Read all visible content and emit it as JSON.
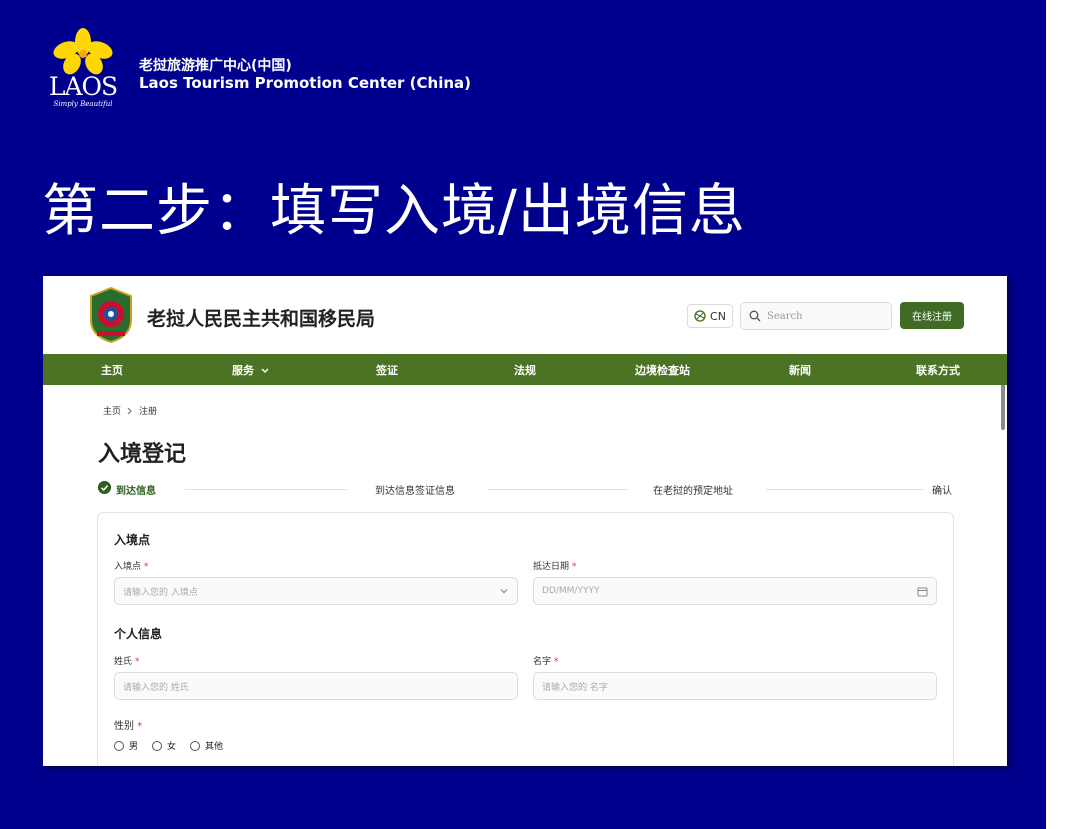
{
  "slide": {
    "org_name_cn": "老挝旅游推广中心(中国)",
    "org_name_en": "Laos Tourism Promotion Center (China)",
    "logo_word": "LAOS",
    "logo_tagline": "Simply Beautiful",
    "title": "第二步：填写入境/出境信息"
  },
  "site": {
    "title": "老挝人民民主共和国移民局",
    "lang_label": "CN",
    "search_placeholder": "Search",
    "register_button": "在线注册"
  },
  "nav": {
    "items": [
      "主页",
      "服务",
      "签证",
      "法规",
      "边境检查站",
      "新闻",
      "联系方式"
    ]
  },
  "breadcrumb": {
    "home": "主页",
    "current": "注册"
  },
  "page": {
    "title": "入境登记"
  },
  "steps": [
    "到达信息",
    "到达信息签证信息",
    "在老挝的预定地址",
    "确认"
  ],
  "form": {
    "entry_section": "入境点",
    "entry_point_label": "入境点",
    "entry_point_placeholder": "请输入您的 入境点",
    "arrival_date_label": "抵达日期",
    "arrival_date_placeholder": "DD/MM/YYYY",
    "personal_section": "个人信息",
    "surname_label": "姓氏",
    "surname_placeholder": "请输入您的 姓氏",
    "given_name_label": "名字",
    "given_name_placeholder": "请输入您的 名字",
    "gender_label": "性别",
    "gender_options": [
      "男",
      "女",
      "其他"
    ],
    "required_mark": "*"
  },
  "colors": {
    "slide_bg": "#00008f",
    "nav_green": "#4a7423",
    "button_green": "#3f6b24",
    "required_red": "#d33333"
  }
}
